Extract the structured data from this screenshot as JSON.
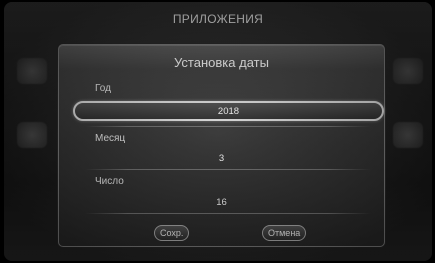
{
  "header": {
    "title": "ПРИЛОЖЕНИЯ"
  },
  "dialog": {
    "title": "Установка даты",
    "fields": [
      {
        "label": "Год",
        "value": "2018"
      },
      {
        "label": "Месяц",
        "value": "3"
      },
      {
        "label": "Число",
        "value": "16"
      }
    ],
    "buttons": {
      "save": "Сохр.",
      "cancel": "Отмена"
    }
  },
  "colors": {
    "selection_border": "#d7d7d7",
    "dialog_bg": "#2e2e2e"
  }
}
